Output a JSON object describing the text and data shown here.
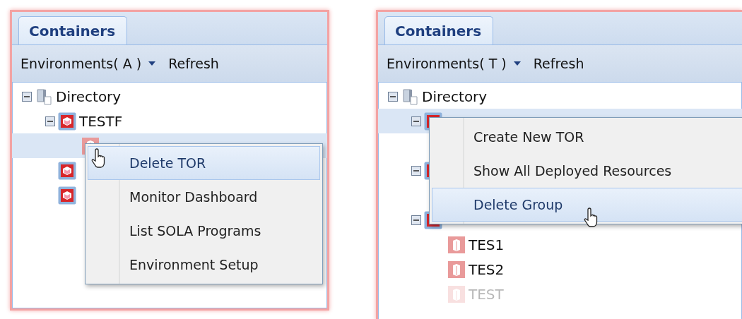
{
  "panels": [
    {
      "tab": {
        "label": "Containers",
        "selected": true
      },
      "toolbar": {
        "environments": "Environments( A )",
        "refresh": "Refresh"
      },
      "tree": [
        {
          "label": "Directory",
          "kind": "directory",
          "expanded": true,
          "selected": false,
          "children": [
            {
              "label": "TESTF",
              "kind": "group",
              "expanded": true,
              "selected": false,
              "children": [
                {
                  "kind": "resource",
                  "selected": true
                }
              ]
            },
            {
              "kind": "group",
              "selected": false
            },
            {
              "kind": "group",
              "selected": false
            }
          ]
        }
      ],
      "menu": {
        "items": [
          {
            "label": "Delete TOR",
            "selected": true
          },
          {
            "label": "Monitor Dashboard",
            "selected": false
          },
          {
            "label": "List SOLA Programs",
            "selected": false
          },
          {
            "label": "Environment Setup",
            "selected": false
          }
        ]
      }
    },
    {
      "tab": {
        "label": "Containers",
        "selected": true
      },
      "toolbar": {
        "environments": "Environments( T )",
        "refresh": "Refresh"
      },
      "tree": [
        {
          "label": "Directory",
          "kind": "directory",
          "expanded": true,
          "selected": false,
          "children": [
            {
              "kind": "group",
              "expanded": true,
              "selected": true
            },
            {
              "kind": "group",
              "expanded": true,
              "selected": false
            },
            {
              "kind": "group",
              "expanded": true,
              "selected": false,
              "children": [
                {
                  "label": "TES1",
                  "kind": "resource",
                  "selected": false,
                  "disabled": false
                },
                {
                  "label": "TES2",
                  "kind": "resource",
                  "selected": false,
                  "disabled": false
                },
                {
                  "label": "TEST",
                  "kind": "resource",
                  "selected": false,
                  "disabled": true
                }
              ]
            }
          ]
        }
      ],
      "menu": {
        "items": [
          {
            "label": "Create New TOR",
            "selected": false
          },
          {
            "label": "Show All Deployed Resources",
            "selected": false
          },
          {
            "label": "Delete Group",
            "selected": true
          }
        ]
      }
    }
  ]
}
